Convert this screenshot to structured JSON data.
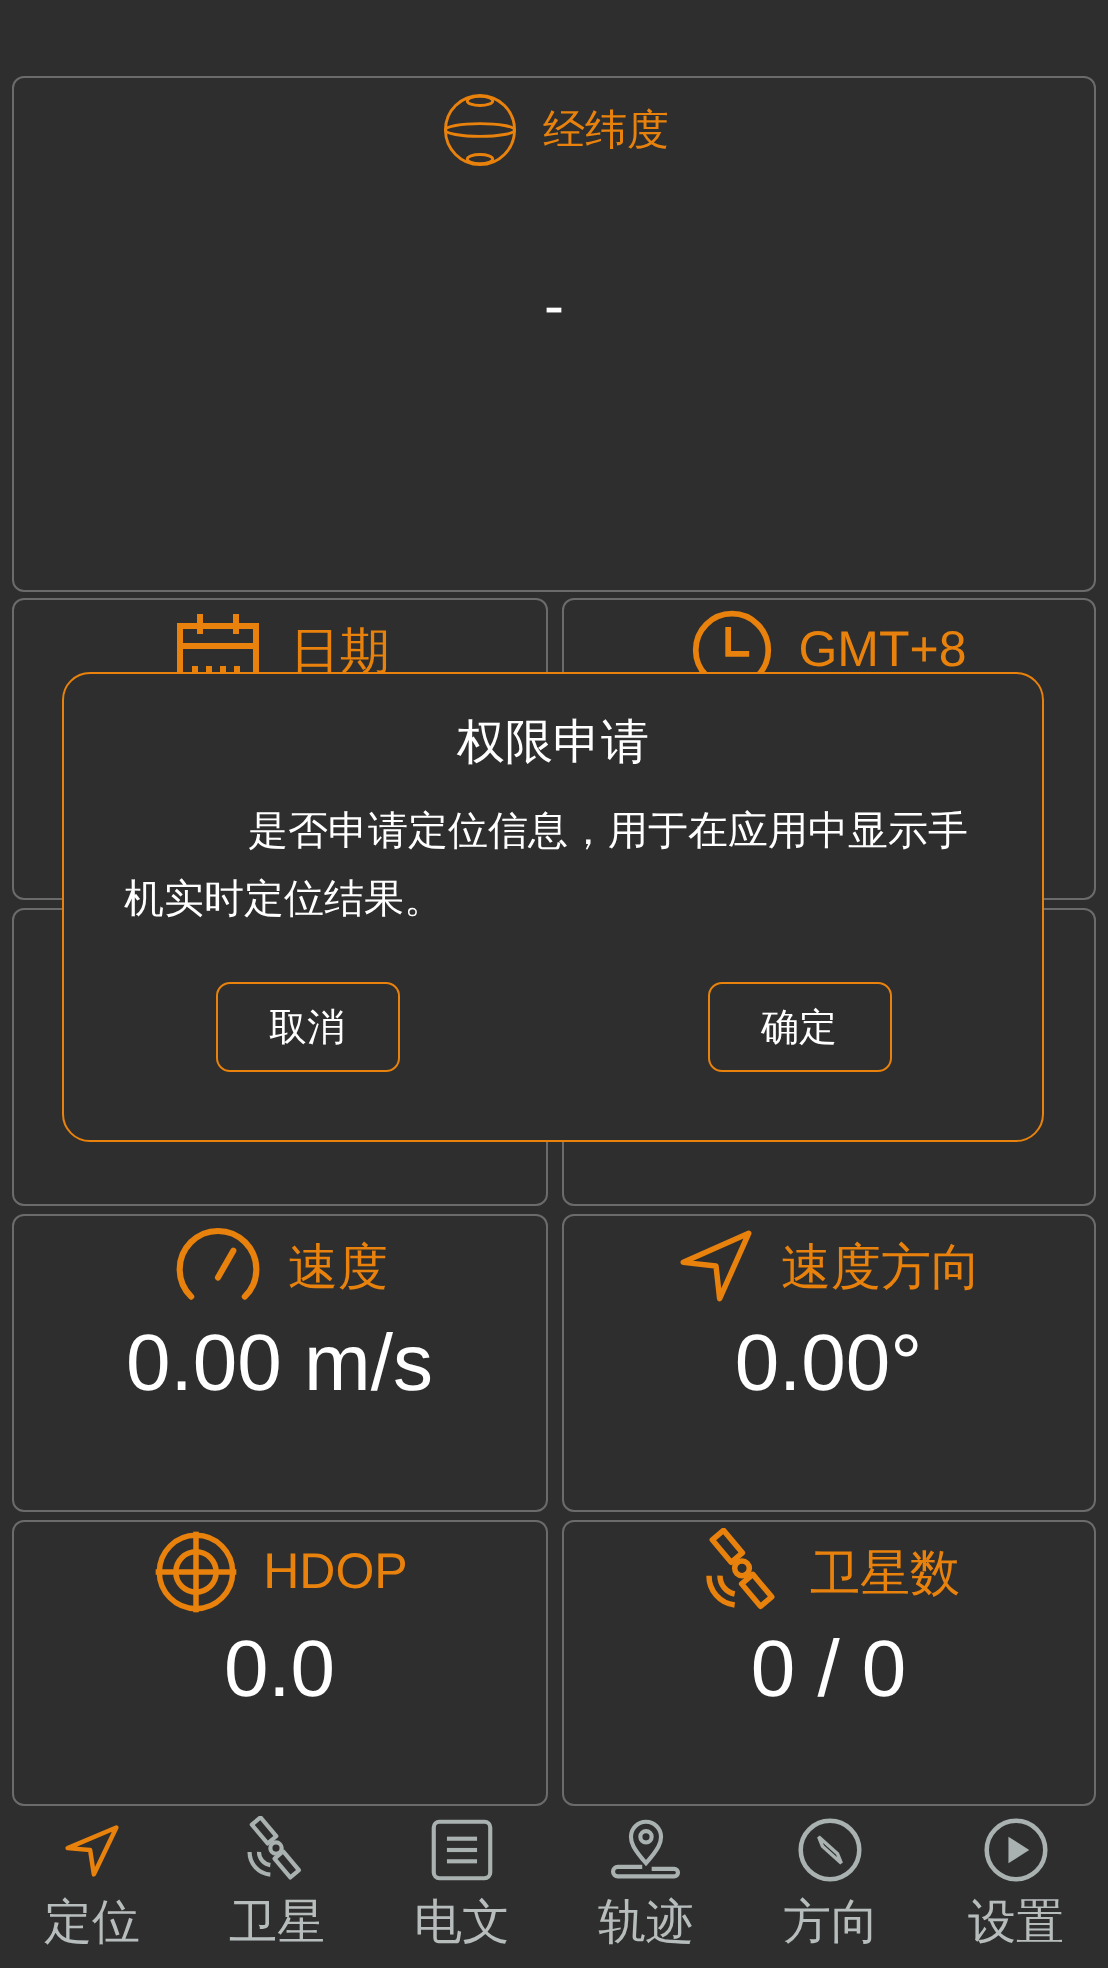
{
  "location": {
    "label": "经纬度",
    "value": "-"
  },
  "cards": [
    {
      "kind": "date",
      "label": "日期"
    },
    {
      "kind": "clock",
      "label": "GMT+8"
    },
    {
      "kind": "blank"
    },
    {
      "kind": "blank"
    },
    {
      "kind": "speed",
      "label": "速度",
      "value": "0.00 m/s"
    },
    {
      "kind": "heading",
      "label": "速度方向",
      "value": "0.00°"
    },
    {
      "kind": "target",
      "label": "HDOP",
      "value": "0.0"
    },
    {
      "kind": "satellite",
      "label": "卫星数",
      "value": "0 / 0"
    }
  ],
  "dialog": {
    "title": "权限申请",
    "message": "是否申请定位信息，用于在应用中显示手机实时定位结果。",
    "buttons": [
      "取消",
      "确定"
    ]
  },
  "nav": [
    {
      "kind": "locate",
      "label": "定位",
      "selected": true
    },
    {
      "kind": "satellite",
      "label": "卫星",
      "selected": false
    },
    {
      "kind": "text",
      "label": "电文",
      "selected": false
    },
    {
      "kind": "track",
      "label": "轨迹",
      "selected": false
    },
    {
      "kind": "compass",
      "label": "方向",
      "selected": false
    },
    {
      "kind": "play",
      "label": "设置",
      "selected": false
    }
  ]
}
